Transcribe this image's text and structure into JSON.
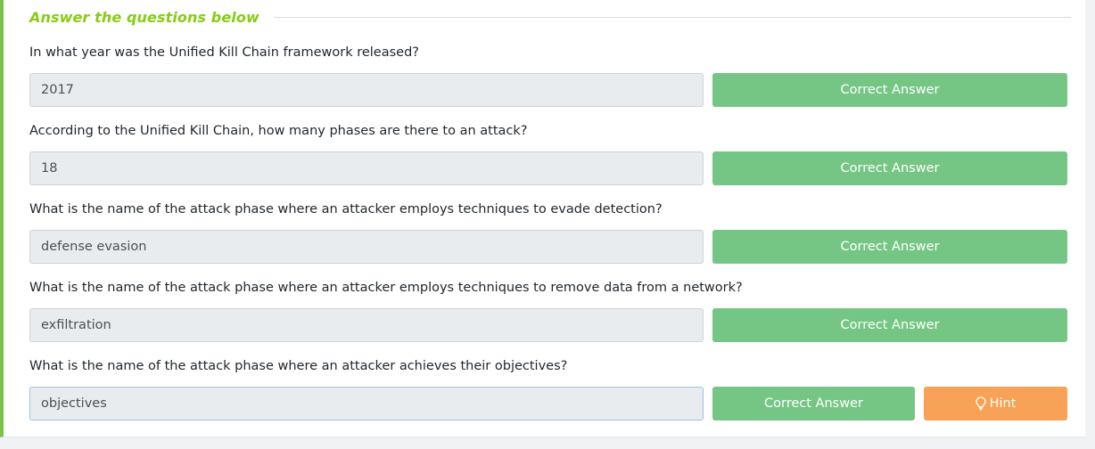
{
  "section": {
    "title": "Answer the questions below"
  },
  "questions": [
    {
      "text": "In what year was the Unified Kill Chain framework released?",
      "answer": "2017",
      "status_label": "Correct Answer"
    },
    {
      "text": "According to the Unified Kill Chain, how many phases are there to an attack?",
      "answer": "18",
      "status_label": "Correct Answer"
    },
    {
      "text": "What is the name of the attack phase where an attacker employs techniques to evade detection?",
      "answer": "defense evasion",
      "status_label": "Correct Answer"
    },
    {
      "text": "What is the name of the attack phase where an attacker employs techniques to remove data from a network?",
      "answer": "exfiltration",
      "status_label": "Correct Answer"
    },
    {
      "text": "What is the name of the attack phase where an attacker achieves their objectives?",
      "answer": "objectives",
      "status_label": "Correct Answer",
      "hint_label": "Hint"
    }
  ],
  "icons": {
    "hint": "lightbulb-icon"
  },
  "colors": {
    "accent": "#88cc14",
    "correct": "#75c685",
    "hint": "#f7a256",
    "panel_border": "#79c24b"
  }
}
